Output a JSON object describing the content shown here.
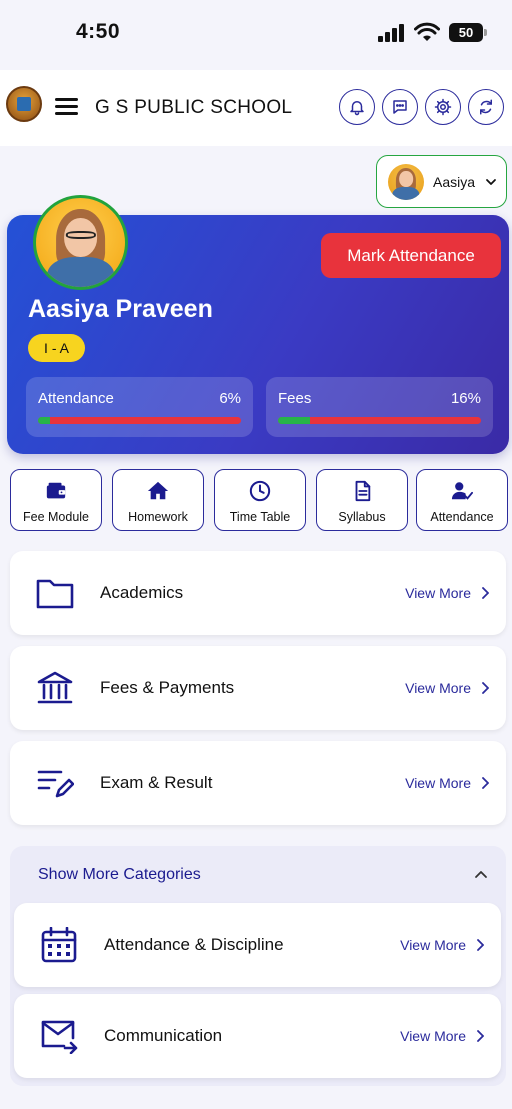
{
  "status_bar": {
    "time": "4:50",
    "battery": "50"
  },
  "header": {
    "school_name": "G S PUBLIC SCHOOL"
  },
  "profile_switch": {
    "name": "Aasiya"
  },
  "student": {
    "name": "Aasiya Praveen",
    "class": "I - A",
    "mark_attendance_label": "Mark Attendance",
    "stats": [
      {
        "label": "Attendance",
        "value": "6%",
        "fraction": 0.06
      },
      {
        "label": "Fees",
        "value": "16%",
        "fraction": 0.16
      }
    ]
  },
  "quick_links": [
    {
      "label": "Fee Module",
      "icon": "wallet-icon"
    },
    {
      "label": "Homework",
      "icon": "home-icon"
    },
    {
      "label": "Time Table",
      "icon": "clock-icon"
    },
    {
      "label": "Syllabus",
      "icon": "document-icon"
    },
    {
      "label": "Attendance",
      "icon": "user-check-icon"
    }
  ],
  "categories": [
    {
      "title": "Academics",
      "icon": "folder-icon",
      "action": "View More"
    },
    {
      "title": "Fees & Payments",
      "icon": "bank-icon",
      "action": "View More"
    },
    {
      "title": "Exam & Result",
      "icon": "list-edit-icon",
      "action": "View More"
    }
  ],
  "more_categories": {
    "title": "Show More Categories",
    "items": [
      {
        "title": "Attendance & Discipline",
        "icon": "calendar-icon",
        "action": "View More"
      },
      {
        "title": "Communication",
        "icon": "mail-send-icon",
        "action": "View More"
      }
    ]
  },
  "colors": {
    "primary": "#2b2b9c",
    "accent_red": "#e8333c",
    "accent_green": "#27b449",
    "badge_yellow": "#f7d41f"
  }
}
